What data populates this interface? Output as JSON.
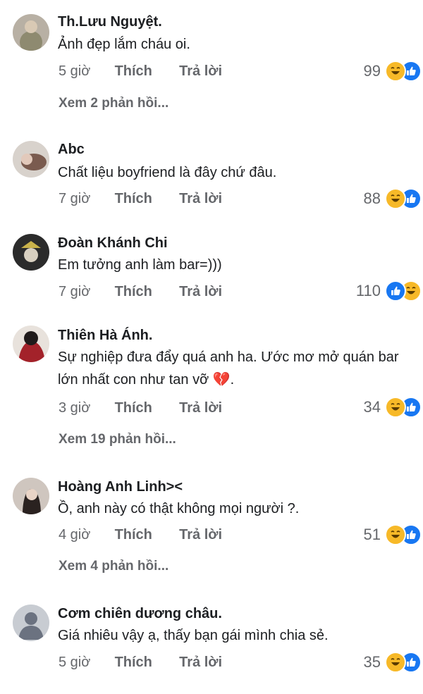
{
  "comments": [
    {
      "name": "Th.Lưu Nguyệt.",
      "text": "Ảnh đẹp lắm cháu oi.",
      "time": "5 giờ",
      "like": "Thích",
      "reply": "Trả lời",
      "count": "99",
      "replies": "Xem 2 phản hồi..."
    },
    {
      "name": "Abc",
      "text": "Chất liệu boyfriend là đây chứ đâu.",
      "time": "7 giờ",
      "like": "Thích",
      "reply": "Trả lời",
      "count": "88"
    },
    {
      "name": "Đoàn Khánh Chi",
      "text": "Em tưởng anh làm bar=)))",
      "time": "7 giờ",
      "like": "Thích",
      "reply": "Trả lời",
      "count": "110"
    },
    {
      "name": "Thiên Hà Ánh.",
      "text": "Sự nghiệp đưa đẩy quá anh ha. Ước mơ mở quán bar lớn nhất con như tan vỡ 💔.",
      "time": "3 giờ",
      "like": "Thích",
      "reply": "Trả lời",
      "count": "34",
      "replies": "Xem 19 phản hồi..."
    },
    {
      "name": "Hoàng Anh Linh><",
      "text": "Ồ, anh này có thật không mọi người ?.",
      "time": "4 giờ",
      "like": "Thích",
      "reply": "Trả lời",
      "count": "51",
      "replies": "Xem 4 phản hồi..."
    },
    {
      "name": "Cơm chiên dương châu.",
      "text": "Giá nhiêu vậy ạ, thấy bạn gái mình chia sẻ.",
      "time": "5 giờ",
      "like": "Thích",
      "reply": "Trả lời",
      "count": "35"
    }
  ],
  "icons": {
    "reaction_haha": "haha-icon",
    "reaction_like": "like-icon"
  },
  "colors": {
    "like": "#1877f2",
    "haha": "#f7b928",
    "meta": "#65676b"
  }
}
